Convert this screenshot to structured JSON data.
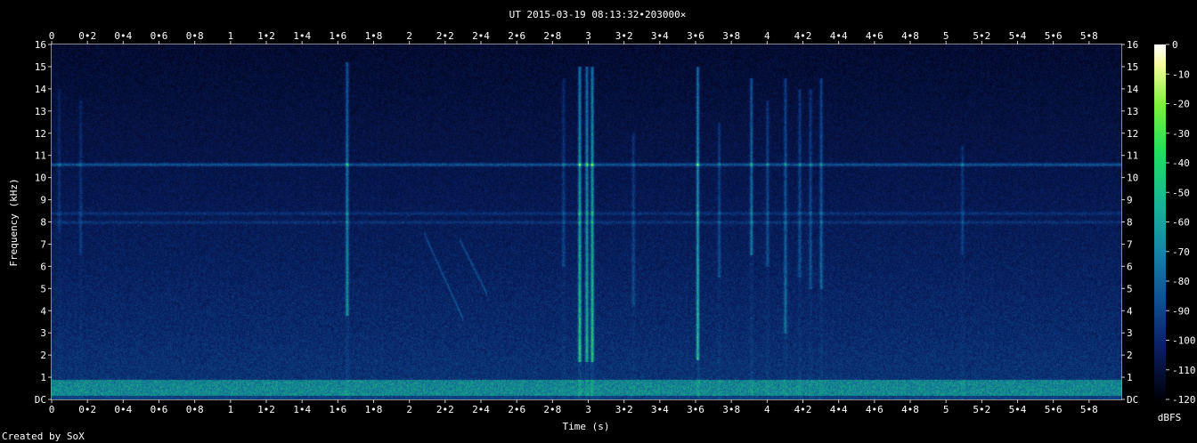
{
  "chart_data": {
    "type": "heatmap",
    "title": "UT 2015-03-19 08:13:32•203000×",
    "xlabel": "Time (s)",
    "ylabel": "Frequency (kHz)",
    "xlim": [
      0,
      5.98
    ],
    "ylim": [
      0,
      16
    ],
    "x_ticks": [
      "0",
      "0•2",
      "0•4",
      "0•6",
      "0•8",
      "1",
      "1•2",
      "1•4",
      "1•6",
      "1•8",
      "2",
      "2•2",
      "2•4",
      "2•6",
      "2•8",
      "3",
      "3•2",
      "3•4",
      "3•6",
      "3•8",
      "4",
      "4•2",
      "4•4",
      "4•6",
      "4•8",
      "5",
      "5•2",
      "5•4",
      "5•6",
      "5•8"
    ],
    "y_ticks": [
      "DC",
      "1",
      "2",
      "3",
      "4",
      "5",
      "6",
      "7",
      "8",
      "9",
      "10",
      "11",
      "12",
      "13",
      "14",
      "15",
      "16"
    ],
    "colorbar": {
      "label": "dBFS",
      "range": [
        -120,
        0
      ],
      "ticks": [
        "0",
        "-10",
        "-20",
        "-30",
        "-40",
        "-50",
        "-60",
        "-70",
        "-80",
        "-90",
        "-100",
        "-110",
        "-120"
      ]
    },
    "features": {
      "horizontal_lines_khz": [
        10.6,
        8.4,
        8.0
      ],
      "low_band_khz": [
        0.2,
        0.9
      ],
      "vertical_bursts": [
        {
          "t": 0.04,
          "f_low": 7.5,
          "f_high": 14.0,
          "strength": 0.25
        },
        {
          "t": 0.16,
          "f_low": 6.5,
          "f_high": 13.5,
          "strength": 0.3
        },
        {
          "t": 1.65,
          "f_low": 3.8,
          "f_high": 15.2,
          "strength": 0.75
        },
        {
          "t": 2.86,
          "f_low": 6.0,
          "f_high": 14.5,
          "strength": 0.35
        },
        {
          "t": 2.95,
          "f_low": 1.7,
          "f_high": 15.0,
          "strength": 1.0
        },
        {
          "t": 2.99,
          "f_low": 1.7,
          "f_high": 15.0,
          "strength": 0.9
        },
        {
          "t": 3.02,
          "f_low": 1.7,
          "f_high": 15.0,
          "strength": 1.0
        },
        {
          "t": 3.25,
          "f_low": 4.2,
          "f_high": 12.0,
          "strength": 0.35
        },
        {
          "t": 3.61,
          "f_low": 1.8,
          "f_high": 15.0,
          "strength": 0.9
        },
        {
          "t": 3.73,
          "f_low": 5.5,
          "f_high": 12.5,
          "strength": 0.4
        },
        {
          "t": 3.91,
          "f_low": 6.5,
          "f_high": 14.5,
          "strength": 0.7
        },
        {
          "t": 4.0,
          "f_low": 6.0,
          "f_high": 13.5,
          "strength": 0.45
        },
        {
          "t": 4.1,
          "f_low": 3.0,
          "f_high": 14.5,
          "strength": 0.55
        },
        {
          "t": 4.18,
          "f_low": 5.5,
          "f_high": 14.0,
          "strength": 0.45
        },
        {
          "t": 4.24,
          "f_low": 5.0,
          "f_high": 14.0,
          "strength": 0.45
        },
        {
          "t": 4.3,
          "f_low": 5.0,
          "f_high": 14.5,
          "strength": 0.55
        },
        {
          "t": 5.09,
          "f_low": 6.5,
          "f_high": 11.5,
          "strength": 0.35
        }
      ],
      "sweeps": [
        {
          "t0": 2.08,
          "f0": 7.5,
          "t1": 2.3,
          "f1": 3.6
        },
        {
          "t0": 2.28,
          "f0": 7.2,
          "t1": 2.43,
          "f1": 4.8
        }
      ]
    }
  },
  "footer": {
    "credit": "Created by SoX"
  }
}
